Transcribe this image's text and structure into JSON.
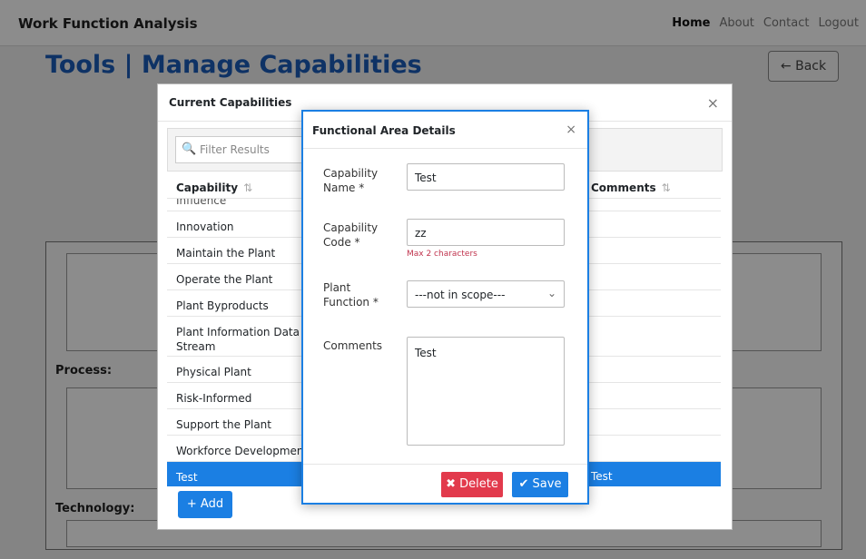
{
  "navbar": {
    "brand": "Work Function Analysis",
    "links": [
      "Home",
      "About",
      "Contact",
      "Logout"
    ]
  },
  "page": {
    "title": "Tools | Manage Capabilities",
    "back_label": "← Back",
    "process_label": "Process:",
    "technology_label": "Technology:"
  },
  "capabilities_modal": {
    "title": "Current Capabilities",
    "close": "×",
    "filter_placeholder": "Filter Results",
    "search_icon": "🔍",
    "col_capability": "Capability",
    "col_comments": "Comments",
    "sort_icon": "⇅",
    "partial_row": "Influence",
    "rows": [
      "Innovation",
      "Maintain the Plant",
      "Operate the Plant",
      "Plant Byproducts",
      "Plant Information Data Stream",
      "Physical Plant",
      "Risk-Informed",
      "Support the Plant",
      "Workforce Development"
    ],
    "selected_row": {
      "capability": "Test",
      "comments": "Test"
    },
    "add_label": "+ Add"
  },
  "functional_area_modal": {
    "title": "Functional Area Details",
    "close": "×",
    "name_label": "Capability Name *",
    "name_value": "Test",
    "code_label": "Capability Code *",
    "code_value": "zz",
    "code_hint": "Max 2 characters",
    "function_label": "Plant Function *",
    "function_value": "---not in scope---",
    "comments_label": "Comments",
    "comments_value": "Test",
    "delete_label": "✖ Delete",
    "save_label": "✔ Save"
  },
  "colors": {
    "accent": "#1b7fe3",
    "danger": "#e23a4c",
    "title": "#1a5bb8"
  }
}
